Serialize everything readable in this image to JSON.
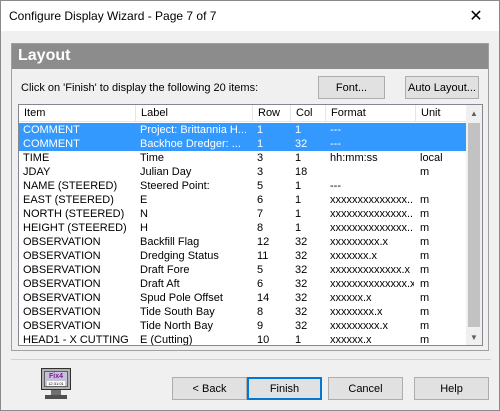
{
  "window": {
    "title": "Configure Display Wizard - Page 7 of 7",
    "close_glyph": "✕"
  },
  "panel": {
    "title": "Layout",
    "instruction": "Click on 'Finish' to display the following 20 items:",
    "font_button": "Font...",
    "auto_layout_button": "Auto Layout..."
  },
  "list": {
    "columns": [
      "Item",
      "Label",
      "Row",
      "Col",
      "Format",
      "Unit"
    ],
    "rows": [
      {
        "item": "COMMENT",
        "label": "Project: Brittannia H...",
        "row": "1",
        "col": "1",
        "format": "---",
        "unit": "",
        "selected": true
      },
      {
        "item": "COMMENT",
        "label": "Backhoe Dredger: ...",
        "row": "1",
        "col": "32",
        "format": "---",
        "unit": "",
        "selected": true
      },
      {
        "item": "TIME",
        "label": "Time",
        "row": "3",
        "col": "1",
        "format": "hh:mm:ss",
        "unit": "local",
        "selected": false
      },
      {
        "item": "JDAY",
        "label": "Julian Day",
        "row": "3",
        "col": "18",
        "format": "",
        "unit": "m",
        "selected": false
      },
      {
        "item": "NAME (STEERED)",
        "label": "Steered Point:",
        "row": "5",
        "col": "1",
        "format": "---",
        "unit": "",
        "selected": false
      },
      {
        "item": "EAST (STEERED)",
        "label": "E",
        "row": "6",
        "col": "1",
        "format": "xxxxxxxxxxxxxx...",
        "unit": "m",
        "selected": false
      },
      {
        "item": "NORTH (STEERED)",
        "label": "N",
        "row": "7",
        "col": "1",
        "format": "xxxxxxxxxxxxxx...",
        "unit": "m",
        "selected": false
      },
      {
        "item": "HEIGHT (STEERED)",
        "label": "H",
        "row": "8",
        "col": "1",
        "format": "xxxxxxxxxxxxxx...",
        "unit": "m",
        "selected": false
      },
      {
        "item": "OBSERVATION",
        "label": "Backfill Flag",
        "row": "12",
        "col": "32",
        "format": "xxxxxxxxx.x",
        "unit": "m",
        "selected": false
      },
      {
        "item": "OBSERVATION",
        "label": "Dredging Status",
        "row": "11",
        "col": "32",
        "format": "xxxxxxx.x",
        "unit": "m",
        "selected": false
      },
      {
        "item": "OBSERVATION",
        "label": "Draft Fore",
        "row": "5",
        "col": "32",
        "format": "xxxxxxxxxxxxx.x",
        "unit": "m",
        "selected": false
      },
      {
        "item": "OBSERVATION",
        "label": "Draft Aft",
        "row": "6",
        "col": "32",
        "format": "xxxxxxxxxxxxxx.x",
        "unit": "m",
        "selected": false
      },
      {
        "item": "OBSERVATION",
        "label": "Spud Pole Offset",
        "row": "14",
        "col": "32",
        "format": "xxxxxx.x",
        "unit": "m",
        "selected": false
      },
      {
        "item": "OBSERVATION",
        "label": "Tide South Bay",
        "row": "8",
        "col": "32",
        "format": "xxxxxxxx.x",
        "unit": "m",
        "selected": false
      },
      {
        "item": "OBSERVATION",
        "label": "Tide North Bay",
        "row": "9",
        "col": "32",
        "format": "xxxxxxxxx.x",
        "unit": "m",
        "selected": false
      },
      {
        "item": "HEAD1 - X CUTTING",
        "label": "E (Cutting)",
        "row": "10",
        "col": "1",
        "format": "xxxxxx.x",
        "unit": "m",
        "selected": false
      }
    ]
  },
  "footer": {
    "logo_brand": "Fix4",
    "logo_time": "12:31:01",
    "back_button": "< Back",
    "finish_button": "Finish",
    "cancel_button": "Cancel",
    "help_button": "Help"
  },
  "colors": {
    "selection": "#3399ff",
    "header_band": "#8c8c8c",
    "default_button_border": "#0078d7"
  },
  "icons": {
    "close": "close-icon",
    "scroll_up": "scroll-up-arrow-icon",
    "scroll_down": "scroll-down-arrow-icon",
    "logo": "fix4-monitor-logo-icon"
  }
}
